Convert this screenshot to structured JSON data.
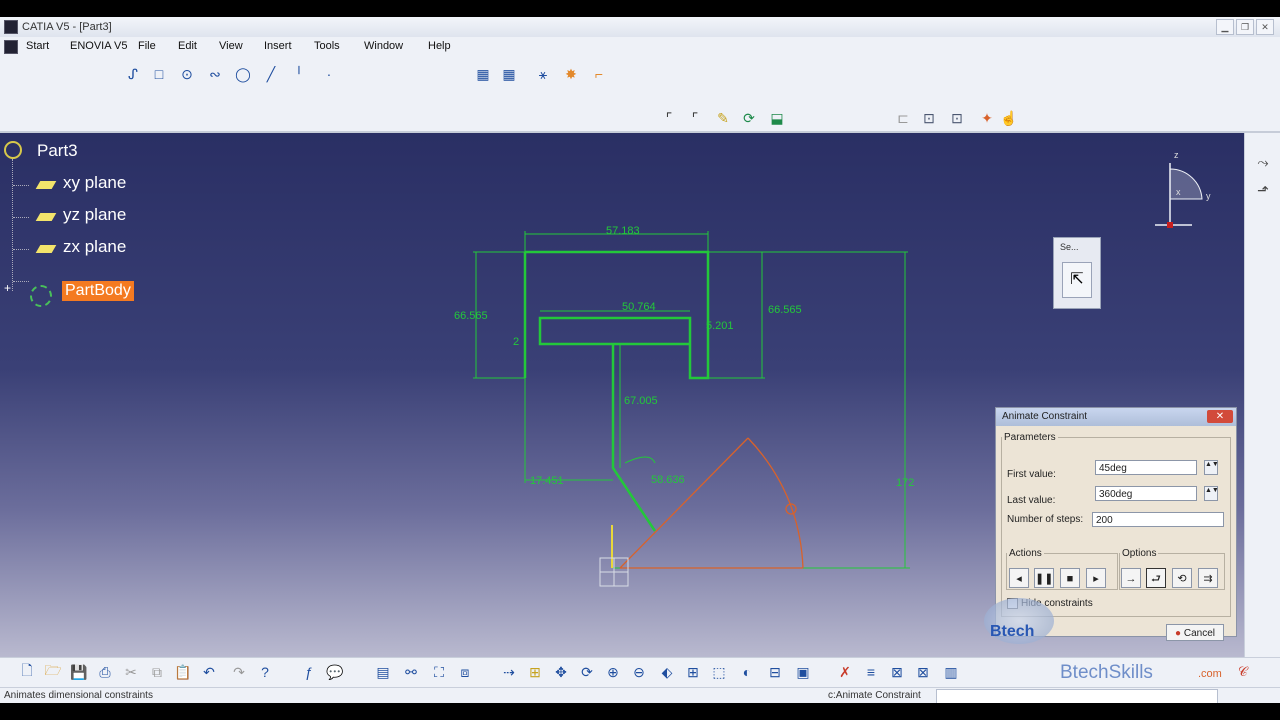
{
  "window": {
    "title": "CATIA V5 - [Part3]"
  },
  "menu": [
    "Start",
    "ENOVIA V5",
    "File",
    "Edit",
    "View",
    "Insert",
    "Tools",
    "Window",
    "Help"
  ],
  "tree": {
    "root": "Part3",
    "items": [
      "xy plane",
      "yz plane",
      "zx plane"
    ],
    "selected": "PartBody"
  },
  "sketch_dims": {
    "top_width": "57.183",
    "left_height": "66.565",
    "right_height": "66.565",
    "inner_width": "50.764",
    "small_right": "5.201",
    "small_left": "2",
    "stem": "67.005",
    "angle_dim": "58.636",
    "bottom_left": "17.451",
    "total_height": "172"
  },
  "select_toolbar": {
    "title": "Se..."
  },
  "axis": {
    "z": "z",
    "y": "y",
    "x": "x"
  },
  "dialog": {
    "title": "Animate Constraint",
    "parameters_legend": "Parameters",
    "first_label": "First value:",
    "first_value": "45deg",
    "last_label": "Last value:",
    "last_value": "360deg",
    "steps_label": "Number of steps:",
    "steps_value": "200",
    "actions_legend": "Actions",
    "options_legend": "Options",
    "hide_label": "Hide constraints",
    "cancel_label": "Cancel"
  },
  "watermark": {
    "brand": "Btech",
    "brand2": "Skills",
    "brand_bar": "BtechSkills",
    "domain": ".com"
  },
  "status": {
    "left": "Animates dimensional constraints",
    "right": "c:Animate Constraint"
  },
  "colors": {
    "sketch": "#23c83a",
    "arc": "#d8622b",
    "selected": "#f47a21",
    "bg_top": "#2a2f64"
  }
}
